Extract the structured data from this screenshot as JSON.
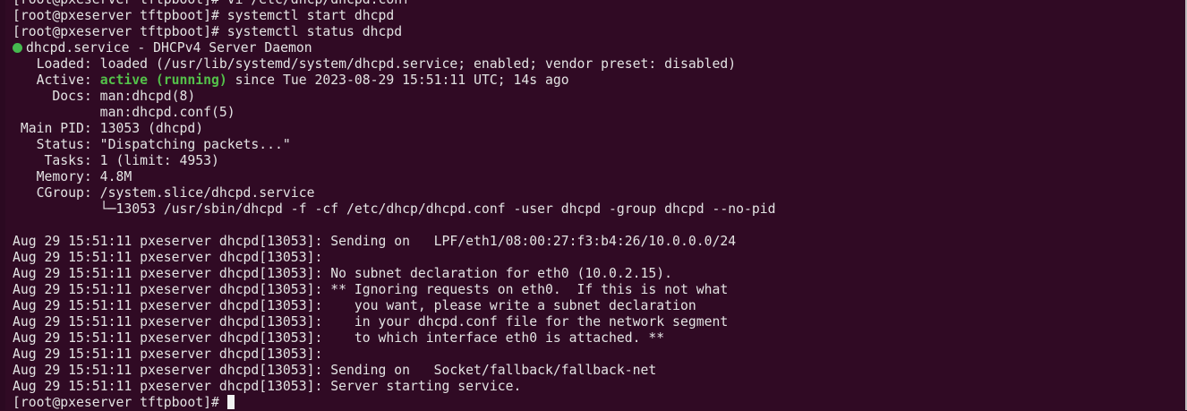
{
  "terminal": {
    "lines": {
      "l0": "[root@pxeserver tftpboot]# vi /etc/dhcp/dhcpd.conf",
      "l1": "[root@pxeserver tftpboot]# systemctl start dhcpd",
      "l2": "[root@pxeserver tftpboot]# systemctl status dhcpd",
      "l3": "dhcpd.service - DHCPv4 Server Daemon",
      "l4": "   Loaded: loaded (/usr/lib/systemd/system/dhcpd.service; enabled; vendor preset: disabled)",
      "l5_prefix": "   Active: ",
      "l5_status": "active (running)",
      "l5_suffix": " since Tue 2023-08-29 15:51:11 UTC; 14s ago",
      "l6": "     Docs: man:dhcpd(8)",
      "l7": "           man:dhcpd.conf(5)",
      "l8": " Main PID: 13053 (dhcpd)",
      "l9": "   Status: \"Dispatching packets...\"",
      "l10": "    Tasks: 1 (limit: 4953)",
      "l11": "   Memory: 4.8M",
      "l12": "   CGroup: /system.slice/dhcpd.service",
      "l13": "           └─13053 /usr/sbin/dhcpd -f -cf /etc/dhcp/dhcpd.conf -user dhcpd -group dhcpd --no-pid",
      "l14": "",
      "l15": "Aug 29 15:51:11 pxeserver dhcpd[13053]: Sending on   LPF/eth1/08:00:27:f3:b4:26/10.0.0.0/24",
      "l16": "Aug 29 15:51:11 pxeserver dhcpd[13053]:",
      "l17": "Aug 29 15:51:11 pxeserver dhcpd[13053]: No subnet declaration for eth0 (10.0.2.15).",
      "l18": "Aug 29 15:51:11 pxeserver dhcpd[13053]: ** Ignoring requests on eth0.  If this is not what",
      "l19": "Aug 29 15:51:11 pxeserver dhcpd[13053]:    you want, please write a subnet declaration",
      "l20": "Aug 29 15:51:11 pxeserver dhcpd[13053]:    in your dhcpd.conf file for the network segment",
      "l21": "Aug 29 15:51:11 pxeserver dhcpd[13053]:    to which interface eth0 is attached. **",
      "l22": "Aug 29 15:51:11 pxeserver dhcpd[13053]:",
      "l23": "Aug 29 15:51:11 pxeserver dhcpd[13053]: Sending on   Socket/fallback/fallback-net",
      "l24": "Aug 29 15:51:11 pxeserver dhcpd[13053]: Server starting service.",
      "prompt": "[root@pxeserver tftpboot]# "
    },
    "colors": {
      "background": "#300a24",
      "foreground": "#e3e3e3",
      "active_status": "#54c14a",
      "service_dot": "#45b94f"
    },
    "icons": {
      "service_status": "green-dot-icon",
      "cursor": "block-cursor-icon"
    }
  }
}
